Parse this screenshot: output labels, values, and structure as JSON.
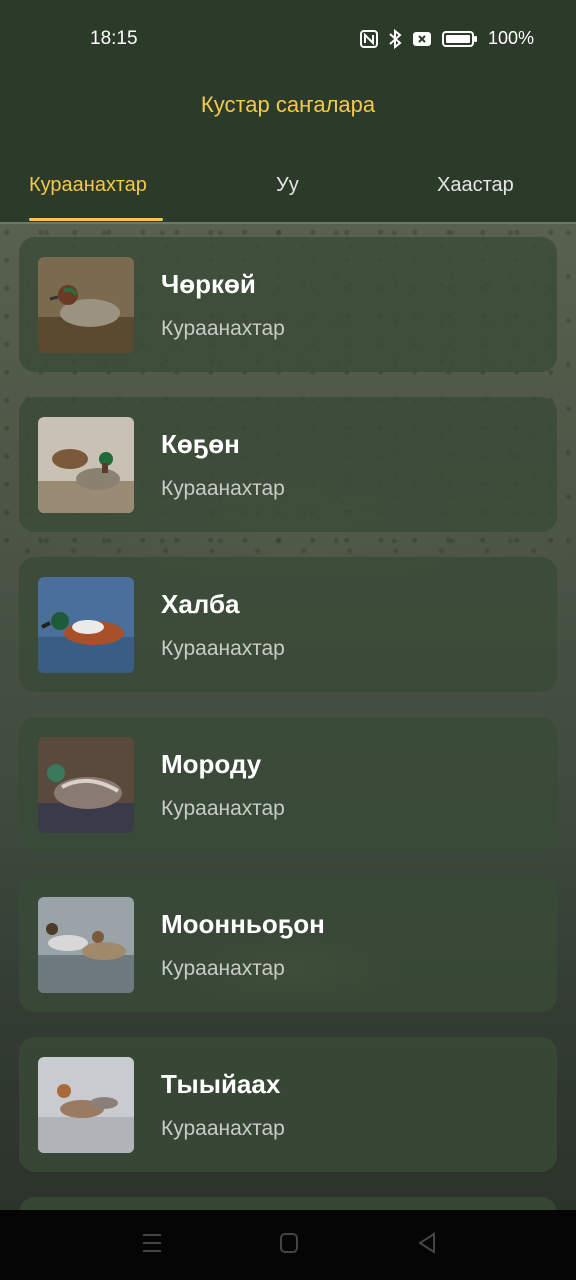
{
  "status_bar": {
    "time": "18:15",
    "battery": "100%",
    "icons": [
      "nfc-icon",
      "bluetooth-icon",
      "sim-off-icon",
      "battery-icon"
    ]
  },
  "app": {
    "title": "Кустар саҥалара"
  },
  "tabs": [
    {
      "label": "Кураанахтар",
      "active": true
    },
    {
      "label": "Уу",
      "active": false
    },
    {
      "label": "Хаастар",
      "active": false
    }
  ],
  "birds": [
    {
      "name": "Чөркөй",
      "category": "Кураанахтар"
    },
    {
      "name": "Көҕөн",
      "category": "Кураанахтар"
    },
    {
      "name": "Халба",
      "category": "Кураанахтар"
    },
    {
      "name": "Мороду",
      "category": "Кураанахтар"
    },
    {
      "name": "Моонньоҕон",
      "category": "Кураанахтар"
    },
    {
      "name": "Тыыйаах",
      "category": "Кураанахтар"
    }
  ],
  "nav": [
    "menu-icon",
    "home-icon",
    "back-icon"
  ],
  "colors": {
    "accent": "#f2c94c",
    "header": "#2c3a2a",
    "card": "#3a4a37"
  }
}
